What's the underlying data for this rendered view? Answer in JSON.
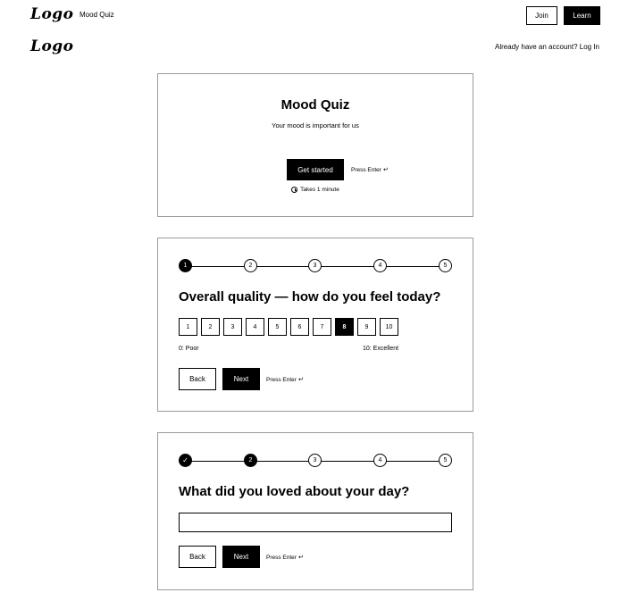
{
  "nav": {
    "logo": "Logo",
    "link": "Mood Quiz",
    "join_label": "Join",
    "learn_label": "Learn"
  },
  "subheader": {
    "logo": "Logo",
    "account_text": "Already have an account? Log In"
  },
  "hero": {
    "title": "Mood Quiz",
    "subtitle": "Your mood is important for us",
    "cta_label": "Get started",
    "press_enter": "Press Enter",
    "enter_icon": "↵",
    "duration": "Takes 1 minute"
  },
  "question1": {
    "steps": [
      "1",
      "2",
      "3",
      "4",
      "5"
    ],
    "current_step": 1,
    "text": "Overall quality — how do you feel today?",
    "scale": [
      "1",
      "2",
      "3",
      "4",
      "5",
      "6",
      "7",
      "8",
      "9",
      "10"
    ],
    "selected_value": "8",
    "min_label": "0: Poor",
    "max_label": "10: Excellent",
    "back_label": "Back",
    "next_label": "Next",
    "press_enter": "Press Enter",
    "enter_icon": "↵"
  },
  "question2": {
    "steps": [
      "✓",
      "2",
      "3",
      "4",
      "5"
    ],
    "current_step": 2,
    "text": "What did you loved about your day?",
    "input_value": "",
    "back_label": "Back",
    "next_label": "Next",
    "press_enter": "Press Enter",
    "enter_icon": "↵"
  }
}
